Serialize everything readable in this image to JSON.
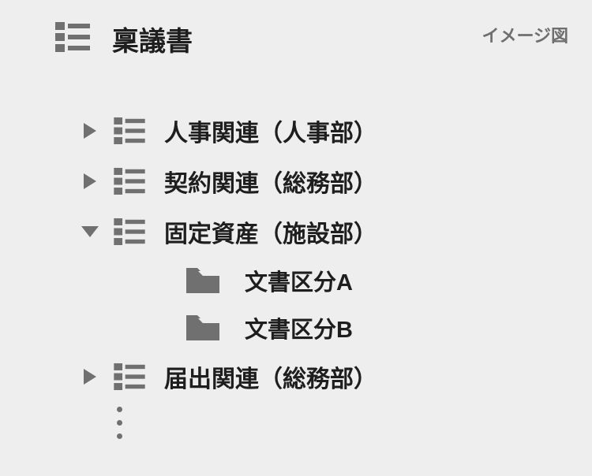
{
  "caption": "イメージ図",
  "root": {
    "label": "稟議書"
  },
  "nodes": [
    {
      "label": "人事関連（人事部）",
      "expanded": false,
      "children": []
    },
    {
      "label": "契約関連（総務部）",
      "expanded": false,
      "children": []
    },
    {
      "label": "固定資産（施設部）",
      "expanded": true,
      "children": [
        {
          "label": "文書区分A"
        },
        {
          "label": "文書区分B"
        }
      ]
    },
    {
      "label": "届出関連（総務部）",
      "expanded": false,
      "children": []
    }
  ],
  "icons": {
    "category": "category-list-icon",
    "folder": "folder-icon",
    "arrow_right": "chevron-right-icon",
    "arrow_down": "chevron-down-icon",
    "more": "more-vertical-icon"
  },
  "colors": {
    "icon": "#707070",
    "text": "#1e1e1e",
    "bg": "#EEEEEE"
  }
}
